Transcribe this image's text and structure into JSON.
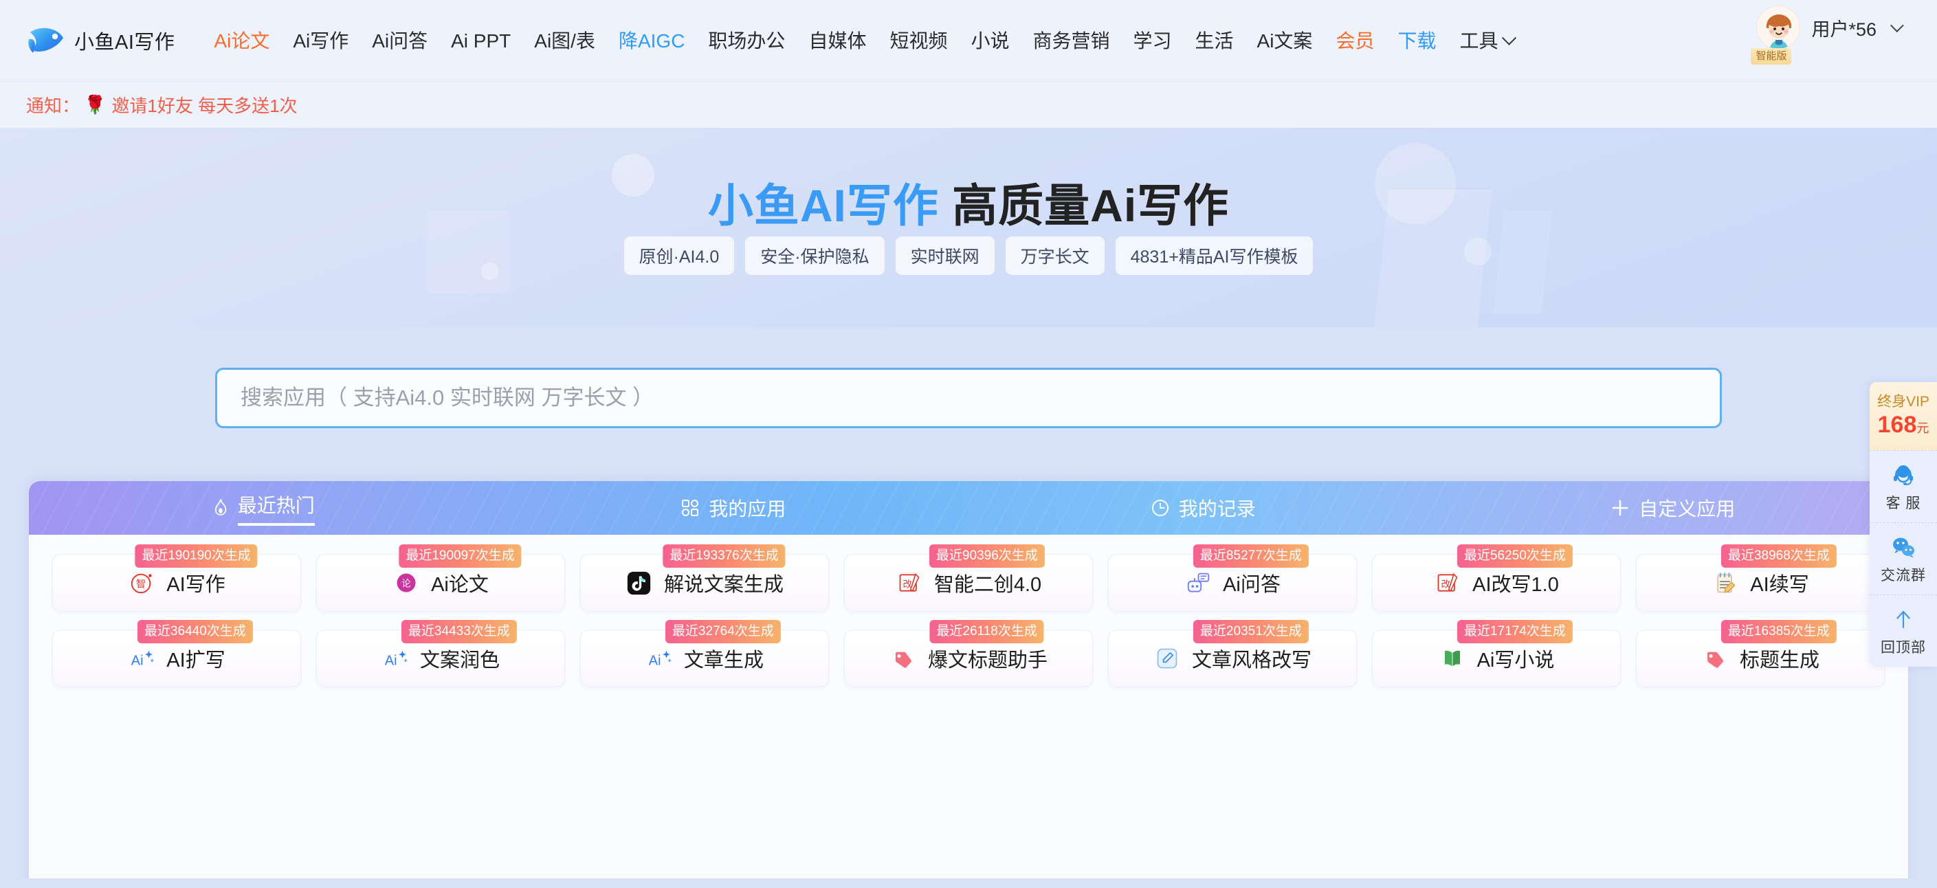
{
  "brand": {
    "name": "小鱼AI写作",
    "logo_icon": "fish-logo-icon"
  },
  "nav": {
    "items": [
      {
        "label": "Ai论文",
        "style": "orange"
      },
      {
        "label": "Ai写作",
        "style": "default"
      },
      {
        "label": "Ai问答",
        "style": "default"
      },
      {
        "label": "Ai PPT",
        "style": "default"
      },
      {
        "label": "Ai图/表",
        "style": "default"
      },
      {
        "label": "降AIGC",
        "style": "blue"
      },
      {
        "label": "职场办公",
        "style": "default"
      },
      {
        "label": "自媒体",
        "style": "default"
      },
      {
        "label": "短视频",
        "style": "default"
      },
      {
        "label": "小说",
        "style": "default"
      },
      {
        "label": "商务营销",
        "style": "default"
      },
      {
        "label": "学习",
        "style": "default"
      },
      {
        "label": "生活",
        "style": "default"
      },
      {
        "label": "Ai文案",
        "style": "default"
      },
      {
        "label": "会员",
        "style": "orange"
      },
      {
        "label": "下载",
        "style": "blue"
      },
      {
        "label": "工具",
        "style": "default",
        "has_chevron": true
      }
    ]
  },
  "user": {
    "name": "用户*56",
    "badge": "智能版",
    "avatar_icon": "avatar"
  },
  "notice": {
    "label": "通知：",
    "emoji": "🌹",
    "text": "邀请1好友 每天多送1次"
  },
  "hero": {
    "title_highlight": "小鱼AI写作",
    "title_rest": " 高质量Ai写作",
    "tags": [
      "原创·AI4.0",
      "安全·保护隐私",
      "实时联网",
      "万字长文",
      "4831+精品AI写作模板"
    ]
  },
  "search": {
    "placeholder": "搜索应用（ 支持Ai4.0 实时联网 万字长文 ）",
    "value": ""
  },
  "tabs": [
    {
      "label": "最近热门",
      "icon": "flame-icon",
      "active": true
    },
    {
      "label": "我的应用",
      "icon": "grid-apps-icon",
      "active": false
    },
    {
      "label": "我的记录",
      "icon": "clock-icon",
      "active": false
    },
    {
      "label": "自定义应用",
      "icon": "plus-icon",
      "active": false
    }
  ],
  "cards": {
    "row1": [
      {
        "title": "AI写作",
        "badge": "最近190190次生成",
        "icon": "seal-zhi-icon"
      },
      {
        "title": "Ai论文",
        "badge": "最近190097次生成",
        "icon": "circle-lun-icon"
      },
      {
        "title": "解说文案生成",
        "badge": "最近193376次生成",
        "icon": "tiktok-note-icon"
      },
      {
        "title": "智能二创4.0",
        "badge": "最近90396次生成",
        "icon": "gai-box-icon"
      },
      {
        "title": "Ai问答",
        "badge": "最近85277次生成",
        "icon": "robot-chat-icon"
      },
      {
        "title": "AI改写1.0",
        "badge": "最近56250次生成",
        "icon": "gai-box-icon"
      },
      {
        "title": "AI续写",
        "badge": "最近38968次生成",
        "icon": "notepad-pencil-icon"
      }
    ],
    "row2": [
      {
        "title": "AI扩写",
        "badge": "最近36440次生成",
        "icon": "ai-sparkle-icon"
      },
      {
        "title": "文案润色",
        "badge": "最近34433次生成",
        "icon": "ai-sparkle-icon"
      },
      {
        "title": "文章生成",
        "badge": "最近32764次生成",
        "icon": "ai-sparkle-icon"
      },
      {
        "title": "爆文标题助手",
        "badge": "最近26118次生成",
        "icon": "tag-icon"
      },
      {
        "title": "文章风格改写",
        "badge": "最近20351次生成",
        "icon": "edit-square-icon"
      },
      {
        "title": "Ai写小说",
        "badge": "最近17174次生成",
        "icon": "open-book-icon"
      },
      {
        "title": "标题生成",
        "badge": "最近16385次生成",
        "icon": "tag-icon"
      }
    ]
  },
  "rail": {
    "vip_title": "终身VIP",
    "vip_price": "168",
    "vip_unit": "元",
    "items": [
      {
        "label": "客 服",
        "icon": "headset-agent-icon"
      },
      {
        "label": "交流群",
        "icon": "wechat-bubbles-icon"
      },
      {
        "label": "回顶部",
        "icon": "arrow-up-icon"
      }
    ]
  },
  "colors": {
    "accent_orange": "#f96c2c",
    "accent_blue": "#2f9bf5",
    "notice_red": "#f2604a",
    "hero_highlight": "#3a9bf7",
    "badge_gradient_start": "#f6628f",
    "badge_gradient_end": "#f7b36a",
    "vip_price": "#f4462f"
  }
}
